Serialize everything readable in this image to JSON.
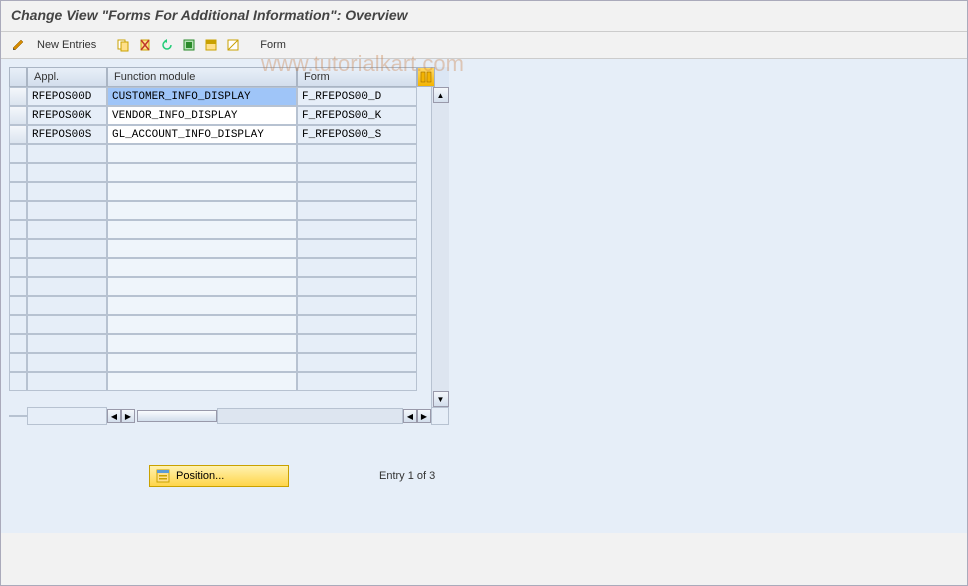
{
  "title": "Change View \"Forms For Additional Information\": Overview",
  "toolbar": {
    "new_entries": "New Entries",
    "form_label": "Form"
  },
  "grid": {
    "headers": {
      "appl": "Appl.",
      "func": "Function module",
      "form": "Form"
    },
    "rows": [
      {
        "appl": "RFEPOS00D",
        "func": "CUSTOMER_INFO_DISPLAY",
        "form": "F_RFEPOS00_D",
        "selected": true
      },
      {
        "appl": "RFEPOS00K",
        "func": "VENDOR_INFO_DISPLAY",
        "form": "F_RFEPOS00_K",
        "selected": false
      },
      {
        "appl": "RFEPOS00S",
        "func": "GL_ACCOUNT_INFO_DISPLAY",
        "form": "F_RFEPOS00_S",
        "selected": false
      }
    ]
  },
  "footer": {
    "position_label": "Position...",
    "entry_text": "Entry 1 of 3"
  },
  "watermark": "www.tutorialkart.com"
}
